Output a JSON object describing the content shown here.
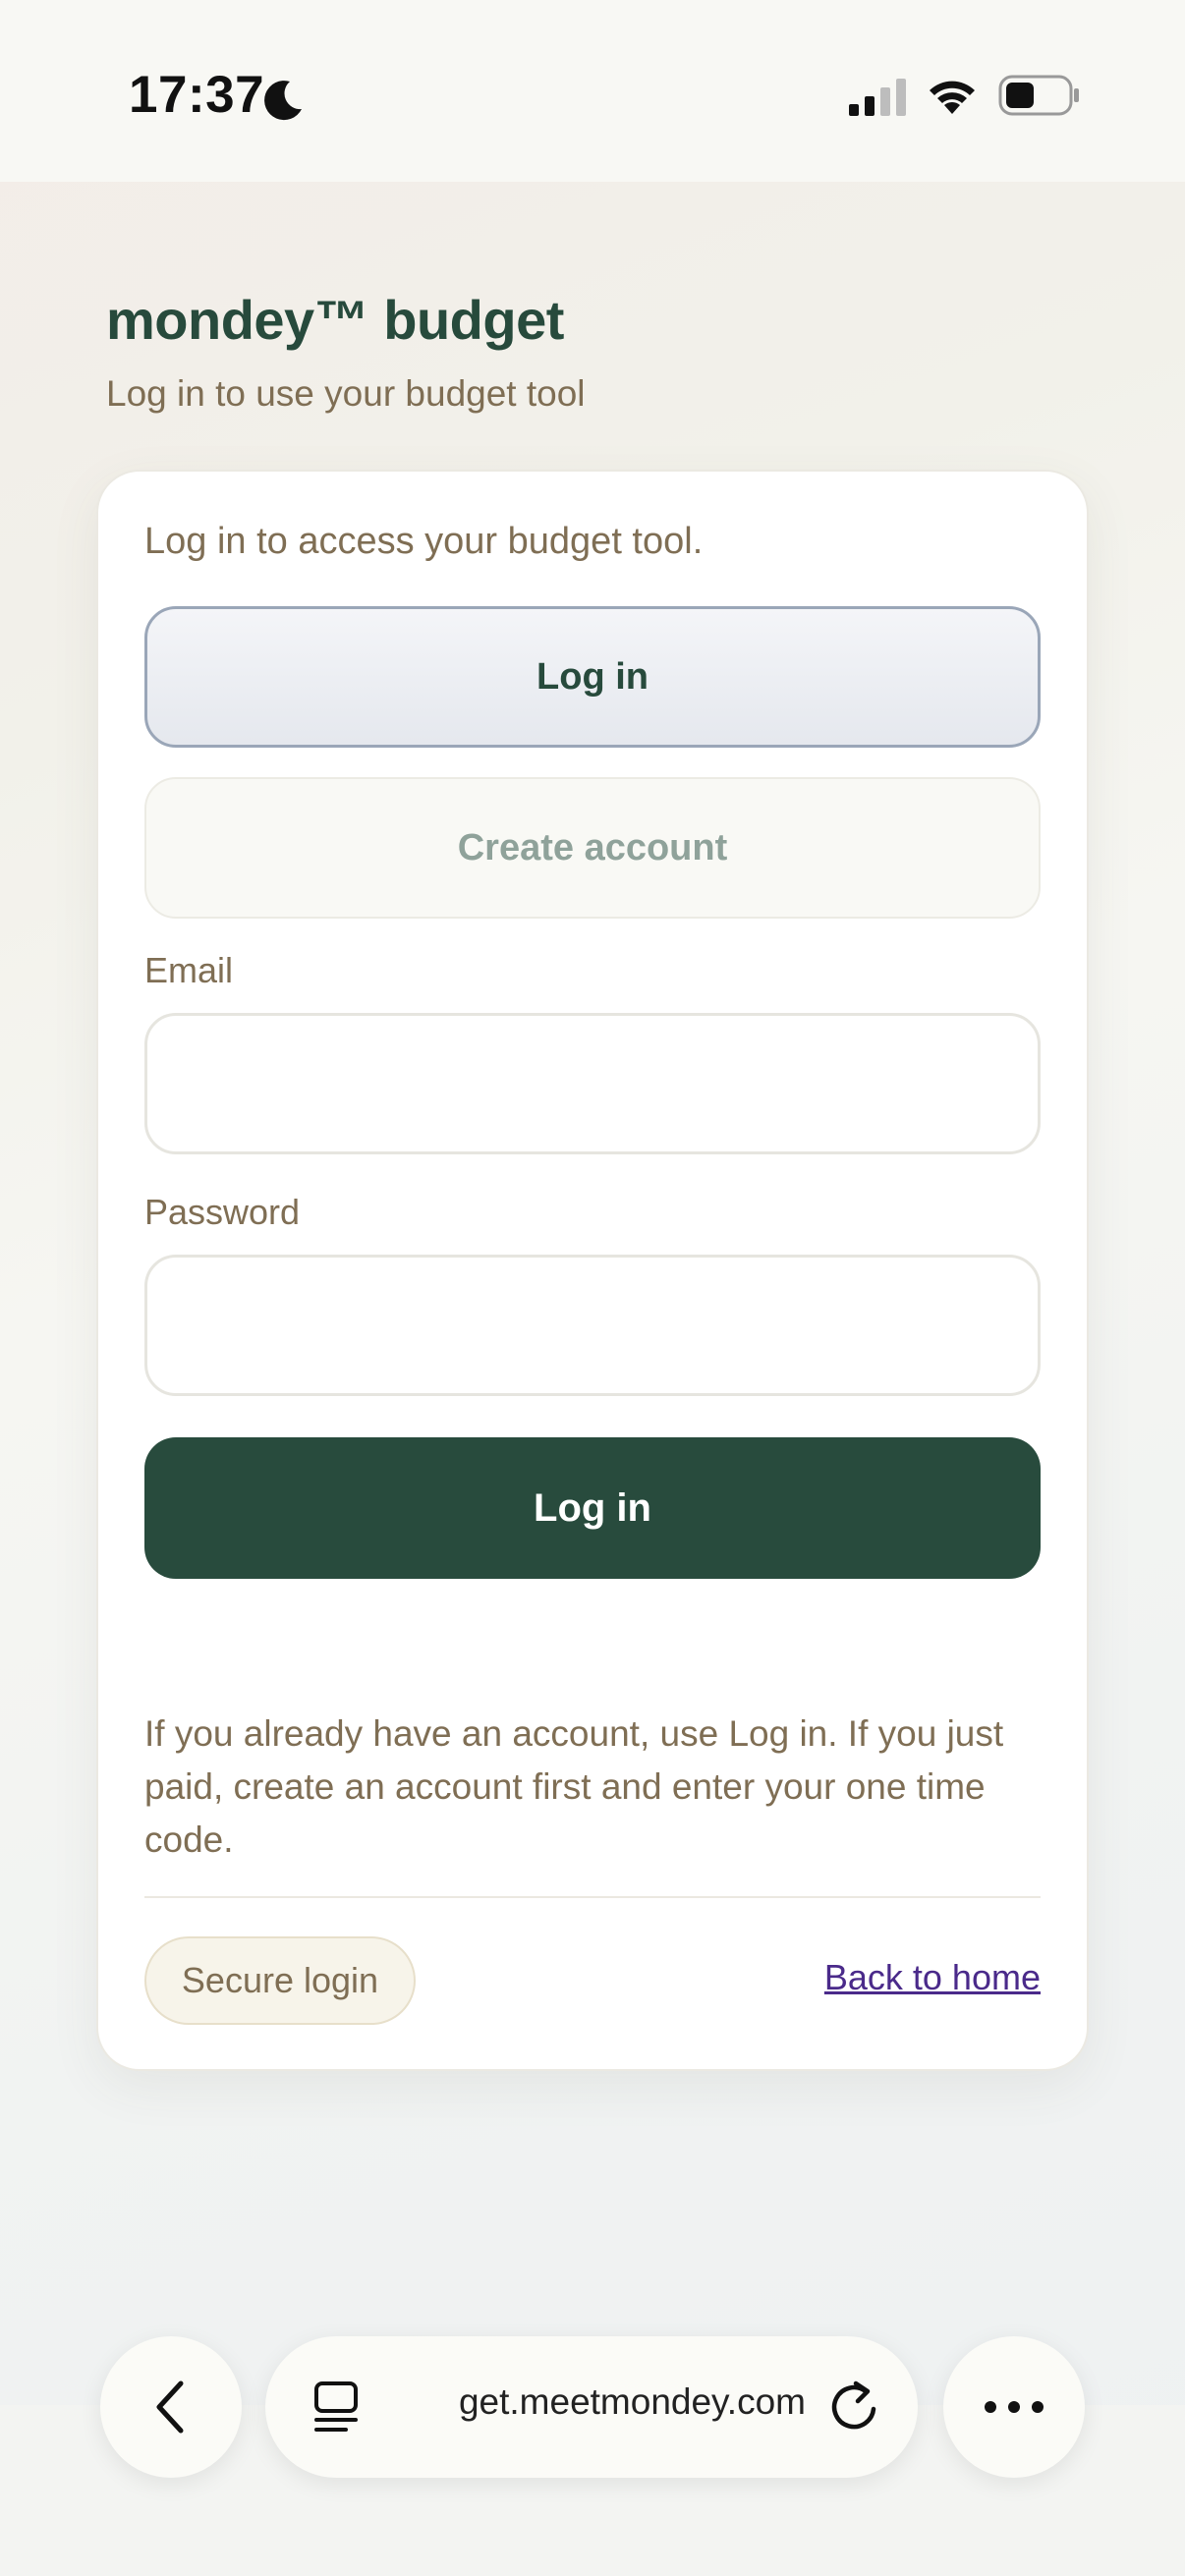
{
  "status_bar": {
    "time": "17:37",
    "icons": [
      "moon-icon",
      "signal-icon",
      "wifi-icon",
      "battery-icon"
    ]
  },
  "brand": {
    "title": "mondey™ budget",
    "subtitle": "Log in to use your budget tool"
  },
  "card": {
    "intro": "Log in to access your budget tool.",
    "tabs": {
      "login_label": "Log in",
      "create_label": "Create account",
      "active": "login"
    },
    "email": {
      "label": "Email",
      "value": "",
      "placeholder": ""
    },
    "password": {
      "label": "Password",
      "value": "",
      "placeholder": ""
    },
    "submit_label": "Log in",
    "help_text": "If you already have an account, use Log in. If you just paid, create an account first and enter your one time code.",
    "secure_badge": "Secure login",
    "back_link": "Back to home"
  },
  "browser": {
    "url": "get.meetmondey.com",
    "icons": [
      "back-icon",
      "tabs-icon",
      "reload-icon",
      "more-icon"
    ]
  },
  "colors": {
    "brand_green": "#284b3d",
    "text_brown": "#7f6e54",
    "link_purple": "#4a2a8a",
    "tab_active_border": "#9aa6b8"
  }
}
